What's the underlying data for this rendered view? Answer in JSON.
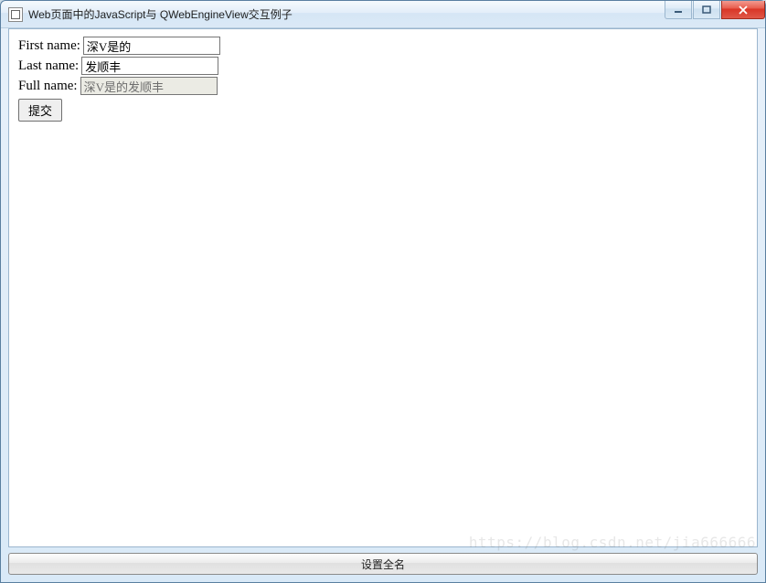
{
  "window": {
    "title": "Web页面中的JavaScript与 QWebEngineView交互例子"
  },
  "form": {
    "first_name_label": "First name:",
    "first_name_value": "深V是的",
    "last_name_label": "Last name:",
    "last_name_value": "发顺丰",
    "full_name_label": "Full name:",
    "full_name_value": "深V是的发顺丰",
    "submit_label": "提交"
  },
  "footer": {
    "set_fullname_label": "设置全名"
  },
  "watermark": "https://blog.csdn.net/jia666666"
}
